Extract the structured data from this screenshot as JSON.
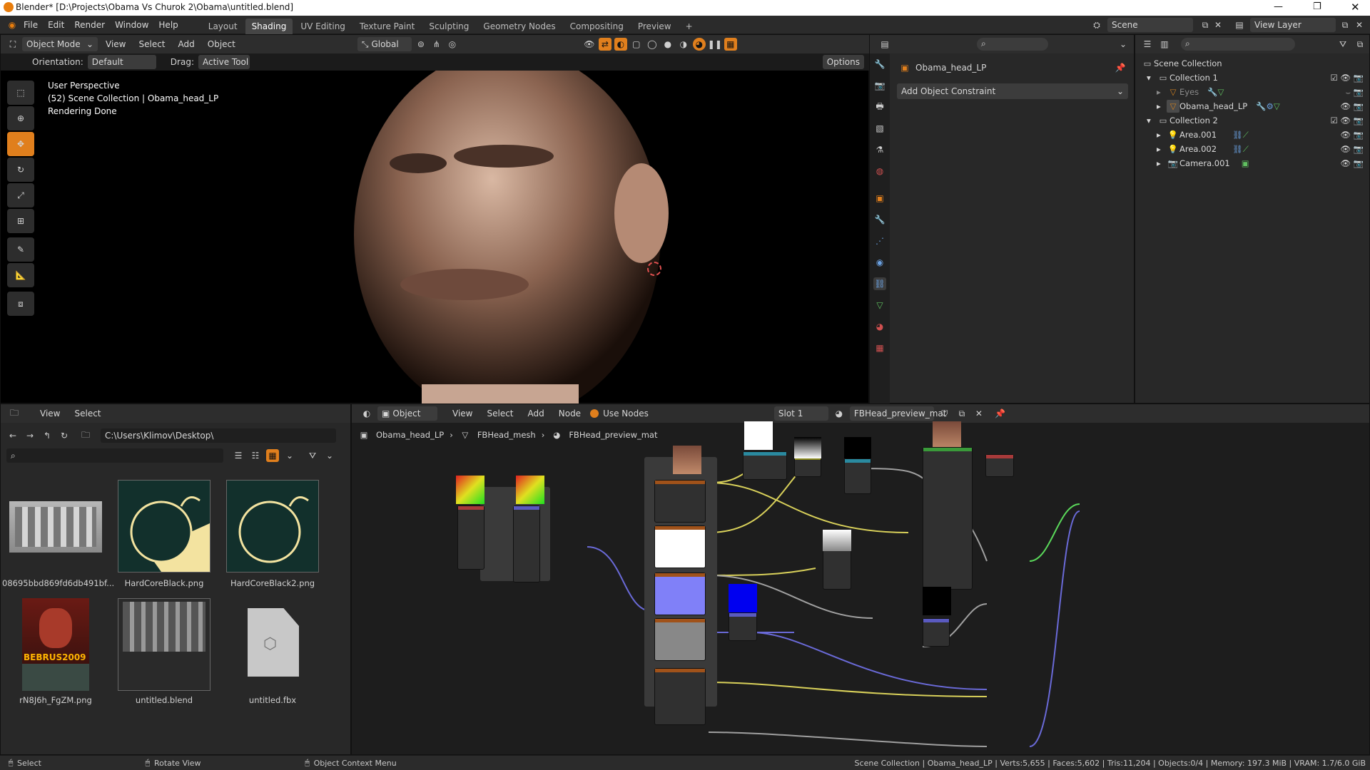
{
  "title_bar": {
    "title": "Blender* [D:\\Projects\\Obama Vs Churok 2\\Obama\\untitled.blend]"
  },
  "menu": {
    "items": [
      "File",
      "Edit",
      "Render",
      "Window",
      "Help"
    ]
  },
  "workspaces": {
    "tabs": [
      "Layout",
      "Shading",
      "UV Editing",
      "Texture Paint",
      "Sculpting",
      "Geometry Nodes",
      "Compositing",
      "Preview"
    ],
    "active": "Shading",
    "add": "+"
  },
  "topright": {
    "scene": "Scene",
    "view_layer": "View Layer"
  },
  "viewport": {
    "mode": "Object Mode",
    "menus": [
      "View",
      "Select",
      "Add",
      "Object"
    ],
    "transform": "Global",
    "orientation_label": "Orientation:",
    "orientation": "Default",
    "drag_label": "Drag:",
    "drag": "Active Tool",
    "options": "Options",
    "overlay_lines": [
      "User Perspective",
      "(52) Scene Collection | Obama_head_LP",
      "Rendering Done"
    ]
  },
  "properties": {
    "object_name": "Obama_head_LP",
    "add_constraint": "Add Object Constraint"
  },
  "outliner": {
    "root": "Scene Collection",
    "items": [
      {
        "label": "Collection 1",
        "level": 1
      },
      {
        "label": "Eyes",
        "level": 2
      },
      {
        "label": "Obama_head_LP",
        "level": 2
      },
      {
        "label": "Collection 2",
        "level": 1
      },
      {
        "label": "Area.001",
        "level": 2
      },
      {
        "label": "Area.002",
        "level": 2
      },
      {
        "label": "Camera.001",
        "level": 2
      }
    ]
  },
  "file_browser": {
    "menus": [
      "View",
      "Select"
    ],
    "path": "C:\\Users\\Klimov\\Desktop\\",
    "files": [
      {
        "name": "08695bbd869fd6db491bf..."
      },
      {
        "name": "HardCoreBlack.png"
      },
      {
        "name": "HardCoreBlack2.png"
      },
      {
        "name": "rN8J6h_FgZM.png",
        "overlay": "BEBRUS2009"
      },
      {
        "name": "untitled.blend"
      },
      {
        "name": "untitled.fbx"
      }
    ]
  },
  "node_editor": {
    "type": "Object",
    "menus": [
      "View",
      "Select",
      "Add",
      "Node"
    ],
    "use_nodes": "Use Nodes",
    "slot": "Slot 1",
    "material": "FBHead_preview_mat",
    "breadcrumb": [
      "Obama_head_LP",
      "FBHead_mesh",
      "FBHead_preview_mat"
    ]
  },
  "status_bar": {
    "left": [
      "Select",
      "Rotate View",
      "Object Context Menu"
    ],
    "right": "Scene Collection | Obama_head_LP | Verts:5,655 | Faces:5,602 | Tris:11,204 | Objects:0/4 | Memory: 197.3 MiB | VRAM: 1.7/6.0 GiB"
  },
  "colors": {
    "accent": "#e07f1d",
    "panel": "#1b1b1b",
    "header": "#2d2d2d"
  }
}
